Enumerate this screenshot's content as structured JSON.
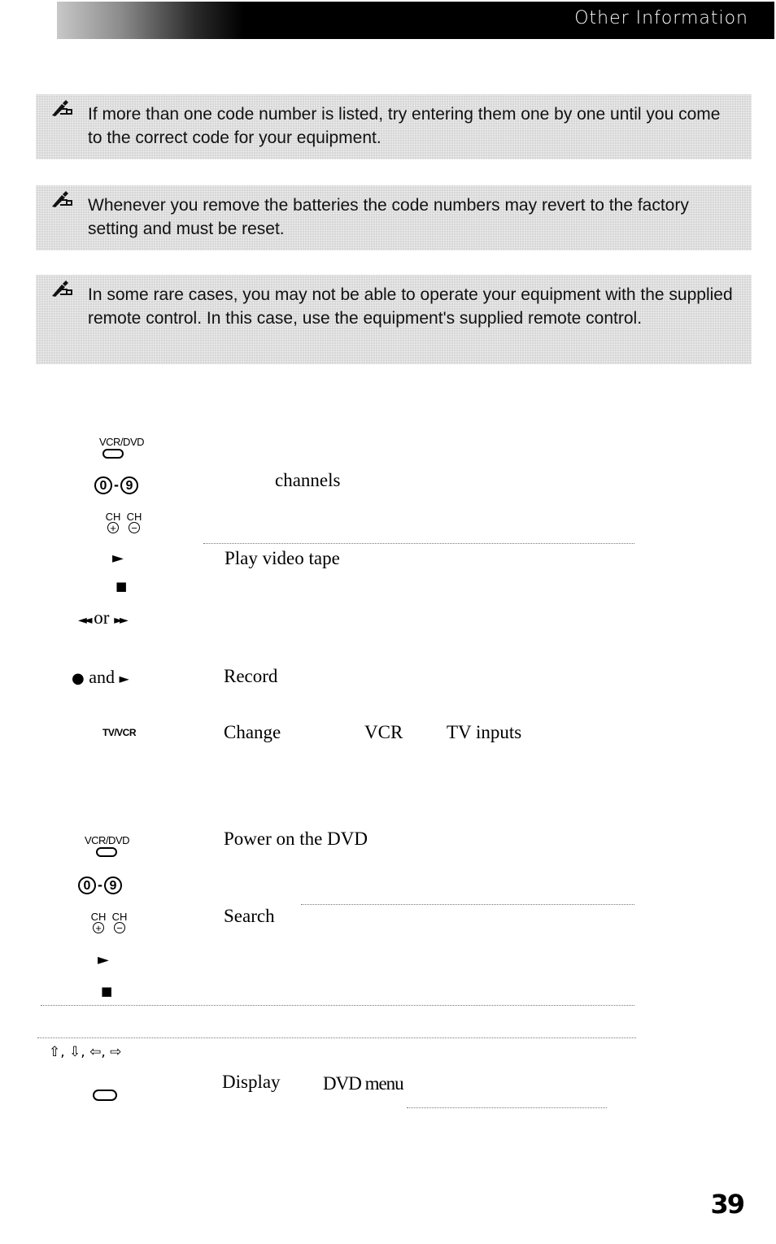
{
  "header": {
    "title": "Other Information"
  },
  "notes": [
    {
      "icon": "pencil-note-icon",
      "text": "If more than one code number is listed, try entering them one by one until you come to the correct code for your equipment."
    },
    {
      "icon": "pencil-note-icon",
      "text": "Whenever you remove the batteries the code numbers may revert to the factory setting and must be reset."
    },
    {
      "icon": "pencil-note-icon",
      "text": "In some rare cases, you may not be able to operate your equipment with the supplied remote control. In this case, use the equipment's supplied remote control."
    }
  ],
  "vcr_section": {
    "rows": [
      {
        "button": "VCR/DVD",
        "desc": ""
      },
      {
        "button_digits": [
          "0",
          "9"
        ],
        "digit_sep": "-",
        "desc": "channels"
      },
      {
        "button_ch": [
          "CH",
          "CH"
        ],
        "ch_signs": [
          "+",
          "−"
        ],
        "desc": ""
      },
      {
        "button_glyph": "►",
        "desc": "Play video tape"
      },
      {
        "button_glyph": "■",
        "desc": ""
      },
      {
        "button_combo": [
          "◄◄",
          "or",
          "►►"
        ],
        "desc": ""
      },
      {
        "button_combo": [
          "●",
          "and",
          "►"
        ],
        "desc": "Record"
      },
      {
        "button": "TV/VCR",
        "desc_parts": [
          "Change",
          "VCR",
          "TV inputs"
        ]
      }
    ]
  },
  "dvd_section": {
    "rows": [
      {
        "button": "VCR/DVD",
        "desc": "Power on the DVD"
      },
      {
        "button_digits": [
          "0",
          "9"
        ],
        "digit_sep": "-",
        "desc": ""
      },
      {
        "button_ch": [
          "CH",
          "CH"
        ],
        "ch_signs": [
          "+",
          "−"
        ],
        "desc": "Search"
      },
      {
        "button_glyph": "►",
        "desc": ""
      },
      {
        "button_glyph": "■",
        "desc": ""
      },
      {
        "button_arrows": "⇧, ⇩, ⇦, ⇨",
        "desc": ""
      },
      {
        "button_oval": "",
        "desc_parts": [
          "Display",
          "DVD menu"
        ]
      }
    ]
  },
  "page_number": "39"
}
